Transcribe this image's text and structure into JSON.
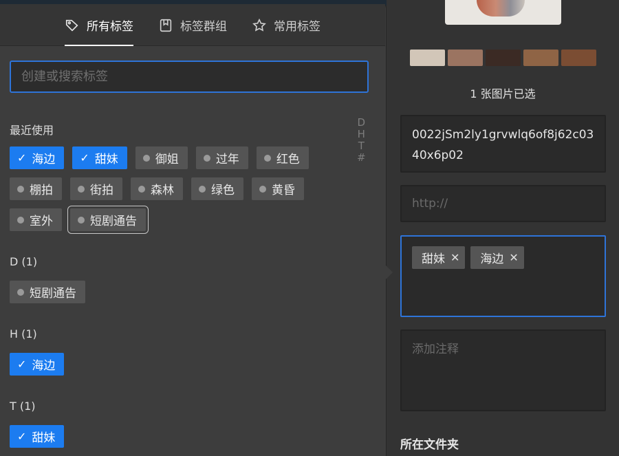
{
  "tabs": [
    {
      "label": "所有标签",
      "icon": "tag-icon",
      "active": true
    },
    {
      "label": "标签群组",
      "icon": "bookmark-icon",
      "active": false
    },
    {
      "label": "常用标签",
      "icon": "star-icon",
      "active": false
    }
  ],
  "search": {
    "placeholder": "创建或搜索标签",
    "value": ""
  },
  "recent": {
    "title": "最近使用",
    "tags": [
      {
        "label": "海边",
        "selected": true
      },
      {
        "label": "甜妹",
        "selected": true
      },
      {
        "label": "御姐",
        "selected": false
      },
      {
        "label": "过年",
        "selected": false
      },
      {
        "label": "红色",
        "selected": false
      },
      {
        "label": "棚拍",
        "selected": false
      },
      {
        "label": "街拍",
        "selected": false
      },
      {
        "label": "森林",
        "selected": false
      },
      {
        "label": "绿色",
        "selected": false
      },
      {
        "label": "黄昏",
        "selected": false
      },
      {
        "label": "室外",
        "selected": false
      },
      {
        "label": "短剧通告",
        "selected": false,
        "hovered": true
      }
    ]
  },
  "groups": [
    {
      "title": "D (1)",
      "tags": [
        {
          "label": "短剧通告",
          "selected": false
        }
      ]
    },
    {
      "title": "H (1)",
      "tags": [
        {
          "label": "海边",
          "selected": true
        }
      ]
    },
    {
      "title": "T (1)",
      "tags": [
        {
          "label": "甜妹",
          "selected": true
        }
      ]
    }
  ],
  "alpha_index": [
    "D",
    "H",
    "T",
    "#"
  ],
  "inspector": {
    "swatches": [
      "#d2c6b8",
      "#9b7461",
      "#3b2a24",
      "#8f6445",
      "#7b4d33"
    ],
    "selected_count": "1 张图片已选",
    "file_name": "0022jSm2ly1grvwlq6of8j62c0340x6p02",
    "url_placeholder": "http://",
    "applied_tags": [
      "甜妹",
      "海边"
    ],
    "remove_glyph": "✕",
    "note_placeholder": "添加注释",
    "folder_label": "所在文件夹"
  },
  "colors": {
    "accent": "#1c7cf0",
    "focus_border": "#2e74d9"
  }
}
